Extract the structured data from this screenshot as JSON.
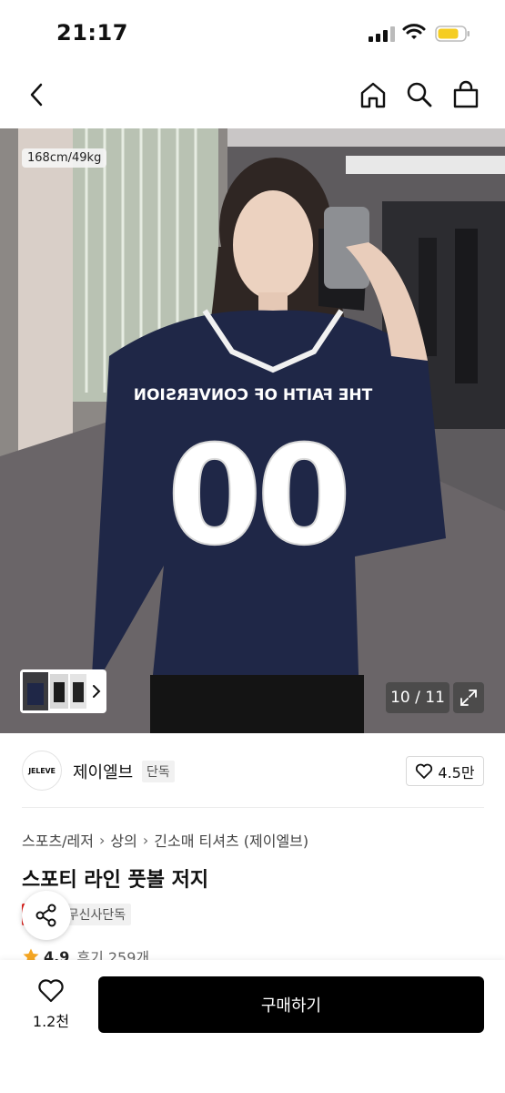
{
  "status_bar": {
    "time": "21:17"
  },
  "product_image": {
    "size_badge": "168cm/49kg",
    "page_counter": "10 / 11",
    "jersey_number": "00",
    "jersey_text": "THE FAITH OF CONVERSION"
  },
  "brand": {
    "logo_text": "JELEVE",
    "name": "제이엘브",
    "tag": "단독",
    "likes": "4.5만"
  },
  "breadcrumb": [
    "스포츠/레저",
    "상의",
    "긴소매 티셔츠 (제이엘브)"
  ],
  "product": {
    "title": "스포티 라인 풋볼 저지",
    "badge_sale": "세일",
    "badge_exclusive": "무신사단독",
    "rating": "4.9",
    "reviews": "후기 259개"
  },
  "bottom_bar": {
    "wish_count": "1.2천",
    "buy_label": "구매하기"
  },
  "colors": {
    "accent_red": "#e0201c",
    "jersey_navy": "#1f2747",
    "star": "#f5a623"
  }
}
